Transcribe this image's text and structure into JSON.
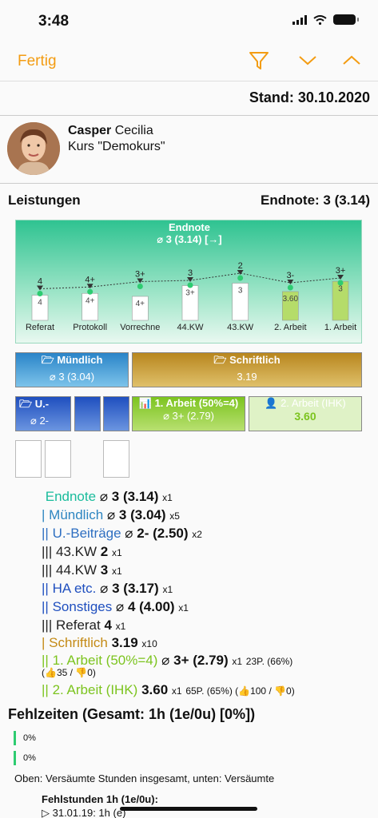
{
  "status_bar": {
    "time": "3:48"
  },
  "navbar": {
    "done_label": "Fertig",
    "accent": "#f39c12"
  },
  "stand": "Stand: 30.10.2020",
  "profile": {
    "last_name": "Casper",
    "first_name": "Cecilia",
    "course": "Kurs \"Demokurs\""
  },
  "section": {
    "title": "Leistungen",
    "endnote": "Endnote: 3 (3.14)"
  },
  "chart_data": {
    "type": "bar",
    "title": "Endnote",
    "subtitle": "⌀ 3 (3.14) [→]",
    "categories": [
      "Referat",
      "Protokoll",
      "Vorrechne",
      "44.KW",
      "43.KW",
      "2. Arbeit",
      "1. Arbeit"
    ],
    "grade_labels": [
      "4",
      "4+",
      "3+",
      "3",
      "2",
      "3-",
      "3+"
    ],
    "value_labels": [
      "4",
      "4+",
      "4+",
      "3+",
      "3",
      "3.60",
      "3"
    ],
    "values": [
      3.9,
      3.75,
      4.0,
      3.1,
      2.9,
      3.6,
      2.75
    ],
    "trend": [
      3.9,
      3.75,
      3.3,
      3.2,
      2.6,
      3.4,
      3.0
    ],
    "ylim": [
      1,
      6
    ]
  },
  "blocks": {
    "muendlich": {
      "title": "Mündlich",
      "value": "⌀ 3 (3.04)"
    },
    "schriftlich": {
      "title": "Schriftlich",
      "value": "3.19"
    },
    "u": {
      "title": "U.-",
      "value": "⌀ 2-"
    },
    "arbeit1": {
      "title": "1. Arbeit (50%=4)",
      "value": "⌀ 3+ (2.79)"
    },
    "arbeit2": {
      "title": "2. Arbeit (IHK)",
      "value": "3.60"
    }
  },
  "summary": [
    {
      "bars": "",
      "label": "Endnote",
      "sym": "⌀",
      "value": "3 (3.14)",
      "mult": "x1",
      "extra": "",
      "color": "#1abc9c"
    },
    {
      "bars": "|",
      "label": "Mündlich",
      "sym": "⌀",
      "value": "3 (3.04)",
      "mult": "x5",
      "extra": "",
      "color": "#2e86c1"
    },
    {
      "bars": "||",
      "label": "U.-Beiträge",
      "sym": "⌀",
      "value": "2- (2.50)",
      "mult": "x2",
      "extra": "",
      "color": "#2e6fc1"
    },
    {
      "bars": "|||",
      "label": "43.KW",
      "sym": "",
      "value": "2",
      "mult": "x1",
      "extra": "",
      "color": "#222"
    },
    {
      "bars": "|||",
      "label": "44.KW",
      "sym": "",
      "value": "3",
      "mult": "x1",
      "extra": "",
      "color": "#222"
    },
    {
      "bars": "||",
      "label": "HA etc.",
      "sym": "⌀",
      "value": "3 (3.17)",
      "mult": "x1",
      "extra": "",
      "color": "#1f4fbf"
    },
    {
      "bars": "||",
      "label": "Sonstiges",
      "sym": "⌀",
      "value": "4 (4.00)",
      "mult": "x1",
      "extra": "",
      "color": "#1f4fbf"
    },
    {
      "bars": "|||",
      "label": "Referat",
      "sym": "",
      "value": "4",
      "mult": "x1",
      "extra": "",
      "color": "#222"
    },
    {
      "bars": "|",
      "label": "Schriftlich",
      "sym": "",
      "value": "3.19",
      "mult": "x10",
      "extra": "",
      "color": "#c48a15"
    },
    {
      "bars": "||",
      "label": "1. Arbeit (50%=4)",
      "sym": "⌀",
      "value": "3+ (2.79)",
      "mult": "x1",
      "extra": "23P. (66%)",
      "color": "#7cc41f"
    },
    {
      "bars": "||",
      "label": "2. Arbeit (IHK)",
      "sym": "",
      "value": "3.60",
      "mult": "x1",
      "extra": "65P. (65%) (👍100 / 👎0)",
      "color": "#7cc41f"
    }
  ],
  "arbeit1_votes": "(👍35 / 👎0)",
  "fehlzeiten": {
    "title": "Fehlzeiten (Gesamt: 1h (1e/0u) [0%])",
    "pct1": "0%",
    "pct2": "0%",
    "note": "Oben: Versäumte Stunden insgesamt, unten: Versäumte",
    "hours_title": "Fehlstunden 1h (1e/0u):",
    "first_entry": "▷ 31.01.19: 1h (e)"
  }
}
